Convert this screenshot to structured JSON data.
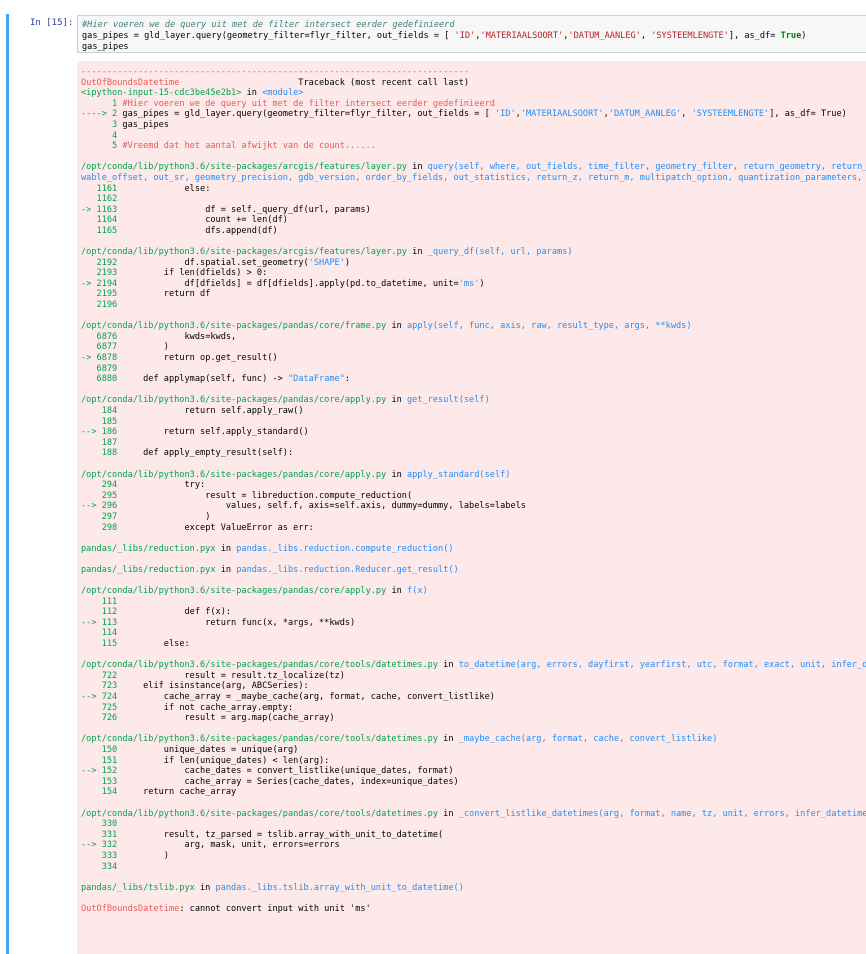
{
  "prompt": "In [15]:",
  "input_lines": [
    {
      "type": "comment",
      "text": "#Hier voeren we de query uit met de filter intersect eerder gedefinieerd"
    },
    {
      "type": "code",
      "parts": [
        {
          "c": "",
          "t": "gas_pipes = gld_layer.query(geometry_filter=flyr_filter, out_fields = [ "
        },
        {
          "c": "str",
          "t": "'ID'"
        },
        {
          "c": "",
          "t": ","
        },
        {
          "c": "str",
          "t": "'MATERIAALSOORT'"
        },
        {
          "c": "",
          "t": ","
        },
        {
          "c": "str",
          "t": "'DATUM_AANLEG'"
        },
        {
          "c": "",
          "t": ", "
        },
        {
          "c": "str",
          "t": "'SYSTEEMLENGTE'"
        },
        {
          "c": "",
          "t": "], as_df= "
        },
        {
          "c": "kw",
          "t": "True"
        },
        {
          "c": "",
          "t": ")"
        }
      ]
    },
    {
      "type": "code",
      "parts": [
        {
          "c": "",
          "t": "gas_pipes"
        }
      ]
    }
  ],
  "output_lines": [
    [
      {
        "c": "red",
        "t": "---------------------------------------------------------------------------"
      }
    ],
    [
      {
        "c": "red",
        "t": "OutOfBoundsDatetime"
      },
      {
        "c": "",
        "t": "                       Traceback (most recent call last)"
      }
    ],
    [
      {
        "c": "green",
        "t": "<ipython-input-15-cdc3be45e2b1>"
      },
      {
        "c": "",
        "t": " in "
      },
      {
        "c": "cyan",
        "t": "<module>"
      }
    ],
    [
      {
        "c": "green",
        "t": "      1 "
      },
      {
        "c": "red",
        "t": "#Hier voeren we de query uit met de filter intersect eerder gedefinieerd"
      }
    ],
    [
      {
        "c": "green",
        "t": "----> 2 "
      },
      {
        "c": "",
        "t": "gas_pipes = gld_layer.query(geometry_filter=flyr_filter, out_fields = [ "
      },
      {
        "c": "cyan",
        "t": "'ID'"
      },
      {
        "c": "",
        "t": ","
      },
      {
        "c": "cyan",
        "t": "'MATERIAALSOORT'"
      },
      {
        "c": "",
        "t": ","
      },
      {
        "c": "cyan",
        "t": "'DATUM_AANLEG'"
      },
      {
        "c": "",
        "t": ", "
      },
      {
        "c": "cyan",
        "t": "'SYSTEEMLENGTE'"
      },
      {
        "c": "",
        "t": "], as_df= True)"
      }
    ],
    [
      {
        "c": "green",
        "t": "      3 "
      },
      {
        "c": "",
        "t": "gas_pipes"
      }
    ],
    [
      {
        "c": "green",
        "t": "      4 "
      }
    ],
    [
      {
        "c": "green",
        "t": "      5 "
      },
      {
        "c": "red",
        "t": "#Vreemd dat het aantal afwijkt van de count......"
      }
    ],
    [],
    [
      {
        "c": "green",
        "t": "/opt/conda/lib/python3.6/site-packages/arcgis/features/layer.py"
      },
      {
        "c": "",
        "t": " in "
      },
      {
        "c": "cyan",
        "t": "query(self, where, out_fields, time_filter, geometry_filter, return_geometry, return_c"
      }
    ],
    [
      {
        "c": "cyan",
        "t": "wable_offset, out_sr, geometry_precision, gdb_version, order_by_fields, out_statistics, return_z, return_m, multipatch_option, quantization_parameters, r"
      }
    ],
    [
      {
        "c": "green",
        "t": "   1161 "
      },
      {
        "c": "",
        "t": "            else:"
      }
    ],
    [
      {
        "c": "green",
        "t": "   1162 "
      }
    ],
    [
      {
        "c": "green",
        "t": "-> 1163 "
      },
      {
        "c": "",
        "t": "                df = self._query_df(url, params)"
      }
    ],
    [
      {
        "c": "green",
        "t": "   1164 "
      },
      {
        "c": "",
        "t": "                count += len(df)"
      }
    ],
    [
      {
        "c": "green",
        "t": "   1165 "
      },
      {
        "c": "",
        "t": "                dfs.append(df)"
      }
    ],
    [],
    [
      {
        "c": "green",
        "t": "/opt/conda/lib/python3.6/site-packages/arcgis/features/layer.py"
      },
      {
        "c": "",
        "t": " in "
      },
      {
        "c": "cyan",
        "t": "_query_df(self, url, params)"
      }
    ],
    [
      {
        "c": "green",
        "t": "   2192 "
      },
      {
        "c": "",
        "t": "            df.spatial.set_geometry("
      },
      {
        "c": "cyan",
        "t": "'SHAPE'"
      },
      {
        "c": "",
        "t": ")"
      }
    ],
    [
      {
        "c": "green",
        "t": "   2193 "
      },
      {
        "c": "",
        "t": "        if len(dfields) > 0:"
      }
    ],
    [
      {
        "c": "green",
        "t": "-> 2194 "
      },
      {
        "c": "",
        "t": "            df[dfields] = df[dfields].apply(pd.to_datetime, unit="
      },
      {
        "c": "cyan",
        "t": "'ms'"
      },
      {
        "c": "",
        "t": ")"
      }
    ],
    [
      {
        "c": "green",
        "t": "   2195 "
      },
      {
        "c": "",
        "t": "        return df"
      }
    ],
    [
      {
        "c": "green",
        "t": "   2196 "
      }
    ],
    [],
    [
      {
        "c": "green",
        "t": "/opt/conda/lib/python3.6/site-packages/pandas/core/frame.py"
      },
      {
        "c": "",
        "t": " in "
      },
      {
        "c": "cyan",
        "t": "apply(self, func, axis, raw, result_type, args, **kwds)"
      }
    ],
    [
      {
        "c": "green",
        "t": "   6876 "
      },
      {
        "c": "",
        "t": "            kwds=kwds,"
      }
    ],
    [
      {
        "c": "green",
        "t": "   6877 "
      },
      {
        "c": "",
        "t": "        )"
      }
    ],
    [
      {
        "c": "green",
        "t": "-> 6878 "
      },
      {
        "c": "",
        "t": "        return op.get_result()"
      }
    ],
    [
      {
        "c": "green",
        "t": "   6879 "
      }
    ],
    [
      {
        "c": "green",
        "t": "   6880 "
      },
      {
        "c": "",
        "t": "    def applymap(self, func) -> "
      },
      {
        "c": "cyan",
        "t": "\"DataFrame\""
      },
      {
        "c": "",
        "t": ":"
      }
    ],
    [],
    [
      {
        "c": "green",
        "t": "/opt/conda/lib/python3.6/site-packages/pandas/core/apply.py"
      },
      {
        "c": "",
        "t": " in "
      },
      {
        "c": "cyan",
        "t": "get_result(self)"
      }
    ],
    [
      {
        "c": "green",
        "t": "    184 "
      },
      {
        "c": "",
        "t": "            return self.apply_raw()"
      }
    ],
    [
      {
        "c": "green",
        "t": "    185 "
      }
    ],
    [
      {
        "c": "green",
        "t": "--> 186 "
      },
      {
        "c": "",
        "t": "        return self.apply_standard()"
      }
    ],
    [
      {
        "c": "green",
        "t": "    187 "
      }
    ],
    [
      {
        "c": "green",
        "t": "    188 "
      },
      {
        "c": "",
        "t": "    def apply_empty_result(self):"
      }
    ],
    [],
    [
      {
        "c": "green",
        "t": "/opt/conda/lib/python3.6/site-packages/pandas/core/apply.py"
      },
      {
        "c": "",
        "t": " in "
      },
      {
        "c": "cyan",
        "t": "apply_standard(self)"
      }
    ],
    [
      {
        "c": "green",
        "t": "    294 "
      },
      {
        "c": "",
        "t": "            try:"
      }
    ],
    [
      {
        "c": "green",
        "t": "    295 "
      },
      {
        "c": "",
        "t": "                result = libreduction.compute_reduction("
      }
    ],
    [
      {
        "c": "green",
        "t": "--> 296 "
      },
      {
        "c": "",
        "t": "                    values, self.f, axis=self.axis, dummy=dummy, labels=labels"
      }
    ],
    [
      {
        "c": "green",
        "t": "    297 "
      },
      {
        "c": "",
        "t": "                )"
      }
    ],
    [
      {
        "c": "green",
        "t": "    298 "
      },
      {
        "c": "",
        "t": "            except ValueError as err:"
      }
    ],
    [],
    [
      {
        "c": "green",
        "t": "pandas/_libs/reduction.pyx"
      },
      {
        "c": "",
        "t": " in "
      },
      {
        "c": "cyan",
        "t": "pandas._libs.reduction.compute_reduction()"
      }
    ],
    [],
    [
      {
        "c": "green",
        "t": "pandas/_libs/reduction.pyx"
      },
      {
        "c": "",
        "t": " in "
      },
      {
        "c": "cyan",
        "t": "pandas._libs.reduction.Reducer.get_result()"
      }
    ],
    [],
    [
      {
        "c": "green",
        "t": "/opt/conda/lib/python3.6/site-packages/pandas/core/apply.py"
      },
      {
        "c": "",
        "t": " in "
      },
      {
        "c": "cyan",
        "t": "f(x)"
      }
    ],
    [
      {
        "c": "green",
        "t": "    111 "
      }
    ],
    [
      {
        "c": "green",
        "t": "    112 "
      },
      {
        "c": "",
        "t": "            def f(x):"
      }
    ],
    [
      {
        "c": "green",
        "t": "--> 113 "
      },
      {
        "c": "",
        "t": "                return func(x, *args, **kwds)"
      }
    ],
    [
      {
        "c": "green",
        "t": "    114 "
      }
    ],
    [
      {
        "c": "green",
        "t": "    115 "
      },
      {
        "c": "",
        "t": "        else:"
      }
    ],
    [],
    [
      {
        "c": "green",
        "t": "/opt/conda/lib/python3.6/site-packages/pandas/core/tools/datetimes.py"
      },
      {
        "c": "",
        "t": " in "
      },
      {
        "c": "cyan",
        "t": "to_datetime(arg, errors, dayfirst, yearfirst, utc, format, exact, unit, infer_da"
      }
    ],
    [
      {
        "c": "green",
        "t": "    722 "
      },
      {
        "c": "",
        "t": "            result = result.tz_localize(tz)"
      }
    ],
    [
      {
        "c": "green",
        "t": "    723 "
      },
      {
        "c": "",
        "t": "    elif isinstance(arg, ABCSeries):"
      }
    ],
    [
      {
        "c": "green",
        "t": "--> 724 "
      },
      {
        "c": "",
        "t": "        cache_array = _maybe_cache(arg, format, cache, convert_listlike)"
      }
    ],
    [
      {
        "c": "green",
        "t": "    725 "
      },
      {
        "c": "",
        "t": "        if not cache_array.empty:"
      }
    ],
    [
      {
        "c": "green",
        "t": "    726 "
      },
      {
        "c": "",
        "t": "            result = arg.map(cache_array)"
      }
    ],
    [],
    [
      {
        "c": "green",
        "t": "/opt/conda/lib/python3.6/site-packages/pandas/core/tools/datetimes.py"
      },
      {
        "c": "",
        "t": " in "
      },
      {
        "c": "cyan",
        "t": "_maybe_cache(arg, format, cache, convert_listlike)"
      }
    ],
    [
      {
        "c": "green",
        "t": "    150 "
      },
      {
        "c": "",
        "t": "        unique_dates = unique(arg)"
      }
    ],
    [
      {
        "c": "green",
        "t": "    151 "
      },
      {
        "c": "",
        "t": "        if len(unique_dates) < len(arg):"
      }
    ],
    [
      {
        "c": "green",
        "t": "--> 152 "
      },
      {
        "c": "",
        "t": "            cache_dates = convert_listlike(unique_dates, format)"
      }
    ],
    [
      {
        "c": "green",
        "t": "    153 "
      },
      {
        "c": "",
        "t": "            cache_array = Series(cache_dates, index=unique_dates)"
      }
    ],
    [
      {
        "c": "green",
        "t": "    154 "
      },
      {
        "c": "",
        "t": "    return cache_array"
      }
    ],
    [],
    [
      {
        "c": "green",
        "t": "/opt/conda/lib/python3.6/site-packages/pandas/core/tools/datetimes.py"
      },
      {
        "c": "",
        "t": " in "
      },
      {
        "c": "cyan",
        "t": "_convert_listlike_datetimes(arg, format, name, tz, unit, errors, infer_datetime_"
      }
    ],
    [
      {
        "c": "green",
        "t": "    330 "
      }
    ],
    [
      {
        "c": "green",
        "t": "    331 "
      },
      {
        "c": "",
        "t": "        result, tz_parsed = tslib.array_with_unit_to_datetime("
      }
    ],
    [
      {
        "c": "green",
        "t": "--> 332 "
      },
      {
        "c": "",
        "t": "            arg, mask, unit, errors=errors"
      }
    ],
    [
      {
        "c": "green",
        "t": "    333 "
      },
      {
        "c": "",
        "t": "        )"
      }
    ],
    [
      {
        "c": "green",
        "t": "    334 "
      }
    ],
    [],
    [
      {
        "c": "green",
        "t": "pandas/_libs/tslib.pyx"
      },
      {
        "c": "",
        "t": " in "
      },
      {
        "c": "cyan",
        "t": "pandas._libs.tslib.array_with_unit_to_datetime()"
      }
    ],
    [],
    [
      {
        "c": "red",
        "t": "OutOfBoundsDatetime"
      },
      {
        "c": "",
        "t": ": cannot convert input with unit 'ms'"
      }
    ]
  ]
}
